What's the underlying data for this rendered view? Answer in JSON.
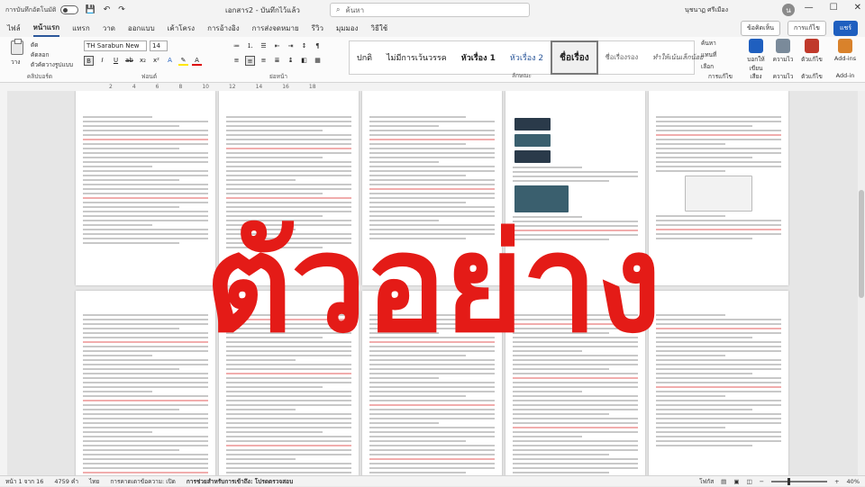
{
  "titlebar": {
    "autosave_label": "การบันทึกอัตโนมัติ",
    "doc_title": "เอกสาร2 - บันทึกไว้แล้ว",
    "search_placeholder": "ค้นหา",
    "user_name": "นุชนาฏ ศรีเมือง",
    "avatar_initial": "น"
  },
  "tabs": [
    "ไฟล์",
    "หน้าแรก",
    "แทรก",
    "วาด",
    "ออกแบบ",
    "เค้าโครง",
    "การอ้างอิง",
    "การส่งจดหมาย",
    "รีวิว",
    "มุมมอง",
    "วิธีใช้"
  ],
  "active_tab": "หน้าแรก",
  "tab_buttons": {
    "comments": "ข้อคิดเห็น",
    "editing": "การแก้ไข",
    "share": "แชร์"
  },
  "ribbon": {
    "clipboard": {
      "paste": "วาง",
      "cut": "ตัด",
      "copy": "คัดลอก",
      "format_painter": "ตัวคัดวางรูปแบบ",
      "label": "คลิปบอร์ด"
    },
    "font": {
      "name": "TH Sarabun New",
      "size": "14",
      "label": "ฟอนต์"
    },
    "paragraph": {
      "label": "ย่อหน้า"
    },
    "styles": {
      "items": [
        "ปกติ",
        "ไม่มีการเว้นวรรค",
        "หัวเรื่อง 1",
        "หัวเรื่อง 2",
        "ชื่อเรื่อง",
        "ชื่อเรื่องรอง",
        "ทำให้เน้นเล็กน้อย"
      ],
      "selected": "ชื่อเรื่อง",
      "label": "ลักษณะ"
    },
    "editing": {
      "find": "ค้นหา",
      "replace": "แทนที่",
      "select": "เลือก",
      "label": "การแก้ไข"
    },
    "voice": {
      "dictate": "บอกให้เขียน",
      "label": "เสียง"
    },
    "sensitivity": {
      "item": "ความไว",
      "label": "ความไว"
    },
    "editor": {
      "item": "ตัวแก้ไข",
      "label": "ตัวแก้ไข"
    },
    "addins": {
      "item": "Add-ins",
      "label": "Add-in"
    }
  },
  "ruler_marks": [
    "2",
    "4",
    "6",
    "8",
    "10",
    "12",
    "14",
    "16",
    "18"
  ],
  "watermark": "ตัวอย่าง",
  "status": {
    "page": "หน้า 1 จาก 16",
    "words": "4759 คำ",
    "lang": "ไทย",
    "predictions": "การคาดเดาข้อความ: เปิด",
    "accessibility": "การช่วยสำหรับการเข้าถึง: โปรดตรวจสอบ",
    "focus": "โฟกัส",
    "zoom": "40%"
  },
  "colors": {
    "accent": "#2b579a",
    "share": "#1f5fbf",
    "watermark": "#e41b17"
  }
}
